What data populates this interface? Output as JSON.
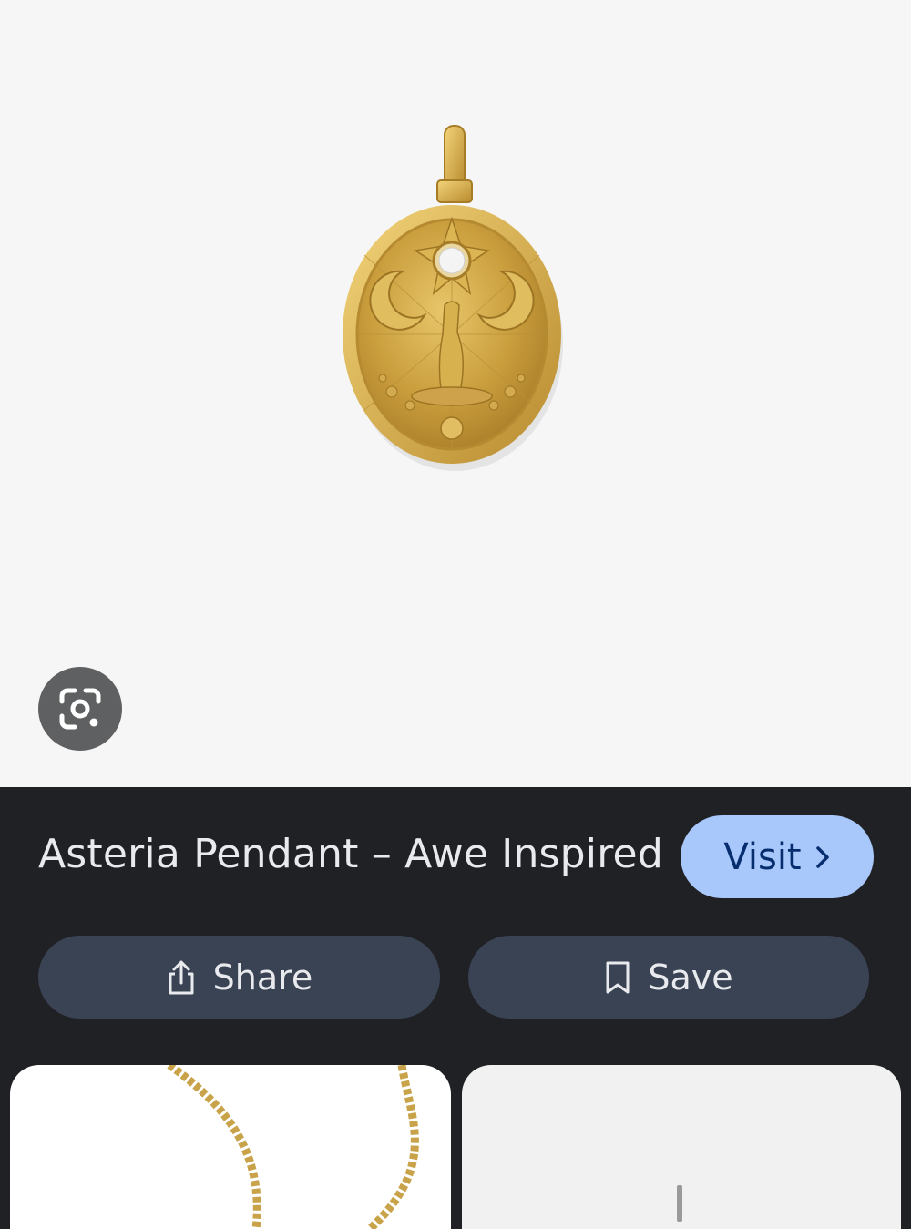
{
  "result": {
    "title": "Asteria Pendant – Awe Inspired",
    "visit_label": "Visit",
    "share_label": "Share",
    "save_label": "Save"
  },
  "icons": {
    "lens": "google-lens-icon",
    "visit_arrow": "chevron-right-icon",
    "share": "share-icon",
    "save": "bookmark-icon"
  },
  "colors": {
    "panel_background": "#202124",
    "visit_button": "#a8c7fa",
    "action_button": "#3a4354",
    "image_background": "#f6f6f6",
    "gold": "#d4ad4a"
  }
}
